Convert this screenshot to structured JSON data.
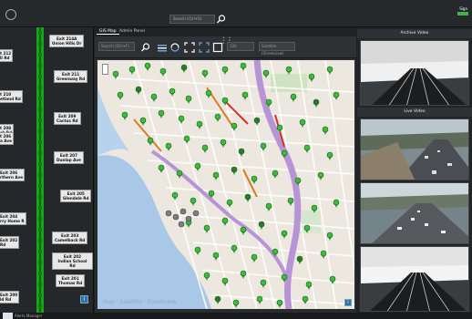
{
  "topbar": {
    "search_placeholder": "Search (Ctrl+S)",
    "sign_label": "Sign",
    "indicator_color": "#3bb24a"
  },
  "freeway": {
    "exits": [
      {
        "exit": "Exit 214A",
        "road": "Union Hills Dr"
      },
      {
        "exit": "Exit 211",
        "road": "Greenway Rd"
      },
      {
        "exit": "Exit 209",
        "road": "Cactus Rd"
      },
      {
        "exit": "Exit 207",
        "road": "Dunlap Ave"
      },
      {
        "exit": "Exit 205",
        "road": "Glendale Rd"
      },
      {
        "exit": "Exit 203",
        "road": "Camelback Rd"
      },
      {
        "exit": "Exit 202",
        "road": "Indian School Rd"
      },
      {
        "exit": "Exit 201",
        "road": "Thomas Rd"
      }
    ],
    "left_labels": [
      {
        "line1": "t 212",
        "line2": "ll Rd"
      },
      {
        "line1": "t 210",
        "line2": "etland Rd"
      },
      {
        "line1": "t 208",
        "line2": "ck Rd"
      },
      {
        "line1": "t 206",
        "line2": "a Ave"
      },
      {
        "line1": "Exit 206",
        "line2": "rthern Ave"
      },
      {
        "line1": "Exit 204",
        "line2": "rry Home R"
      },
      {
        "line1": "Exit 202",
        "line2": "Rd"
      },
      {
        "line1": "Exit 200",
        "line2": "ld Rd"
      }
    ],
    "side_button": "i",
    "road_color": "#1aa21a"
  },
  "map_panel": {
    "tabs": [
      "GIS Map",
      "Admin Panel"
    ],
    "search_placeholder": "Search (Ctrl+F)",
    "zoom_value": "100",
    "layer_select": "Satellite (Streetview)",
    "map_watermark": "Map · Satellite · Streetview",
    "corner_button": "i"
  },
  "video": {
    "archive_title": "Archive Video",
    "live_title": "Live Video"
  },
  "status": {
    "text": "Alerts Manager"
  }
}
